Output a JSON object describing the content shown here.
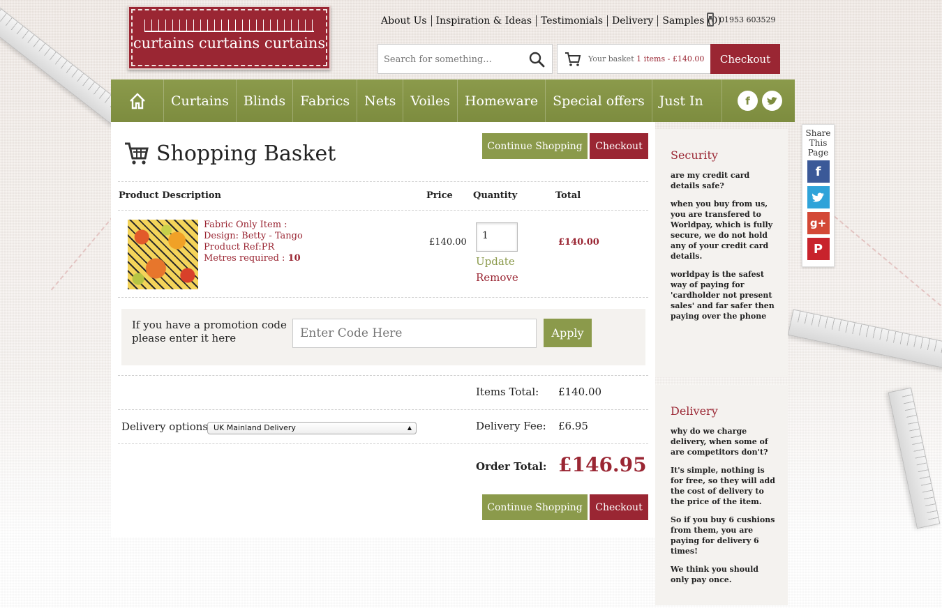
{
  "brand": {
    "logo_text": "curtains curtains curtains"
  },
  "toplinks": [
    {
      "label": "About Us"
    },
    {
      "label": "Inspiration & Ideas"
    },
    {
      "label": "Testimonials"
    },
    {
      "label": "Delivery"
    },
    {
      "label": "Samples (0)"
    }
  ],
  "phone": "01953 603529",
  "search": {
    "placeholder": "Search for something..."
  },
  "basket": {
    "label": "Your basket",
    "summary": "1 items - £140.00",
    "checkout_label": "Checkout"
  },
  "nav": [
    {
      "label": "Curtains"
    },
    {
      "label": "Blinds"
    },
    {
      "label": "Fabrics"
    },
    {
      "label": "Nets"
    },
    {
      "label": "Voiles"
    },
    {
      "label": "Homeware"
    },
    {
      "label": "Special offers"
    },
    {
      "label": "Just In"
    }
  ],
  "page": {
    "title": "Shopping Basket",
    "continue_label": "Continue Shopping",
    "checkout_label": "Checkout"
  },
  "table": {
    "headers": {
      "description": "Product Description",
      "price": "Price",
      "quantity": "Quantity",
      "total": "Total"
    },
    "rows": [
      {
        "lines": [
          "Fabric Only Item :",
          "Design: Betty - Tango",
          "Product Ref:PR"
        ],
        "metres_label": "Metres required : ",
        "metres_value": "10",
        "price": "£140.00",
        "quantity": "1",
        "update_label": "Update",
        "remove_label": "Remove",
        "total": "£140.00"
      }
    ]
  },
  "promo": {
    "label": "If you have a promotion code please enter it here",
    "placeholder": "Enter Code Here",
    "apply_label": "Apply"
  },
  "summary": {
    "items_total_label": "Items Total:",
    "items_total": "£140.00",
    "delivery_options_label": "Delivery options",
    "delivery_option_selected": "UK Mainland Delivery",
    "delivery_fee_label": "Delivery Fee:",
    "delivery_fee": "£6.95",
    "order_total_label": "Order Total:",
    "order_total": "£146.95"
  },
  "sidebar": {
    "security": {
      "heading": "Security",
      "paras": [
        "are my credit card details safe?",
        "when you buy from us, you are transfered to Worldpay, which is fully secure, we do not hold any of your credit card details.",
        "worldpay is the safest way of paying for 'cardholder not present sales' and far safer then paying over the phone"
      ]
    },
    "delivery": {
      "heading": "Delivery",
      "paras": [
        "why do we charge delivery, when some of are competitors don't?",
        " It's simple, nothing is for free, so they will add the cost of delivery to the price of the item.",
        "So if you buy 6 cushions from them, you are paying for delivery 6 times!",
        "We think you should only pay once."
      ]
    }
  },
  "share": {
    "label": "Share This Page",
    "colors": {
      "facebook": "#3b5998",
      "twitter": "#2fa3d9",
      "googleplus": "#d34836",
      "pinterest": "#c8232c"
    }
  },
  "colors": {
    "brand_red": "#9a2633",
    "brand_green": "#8b9a4b"
  }
}
